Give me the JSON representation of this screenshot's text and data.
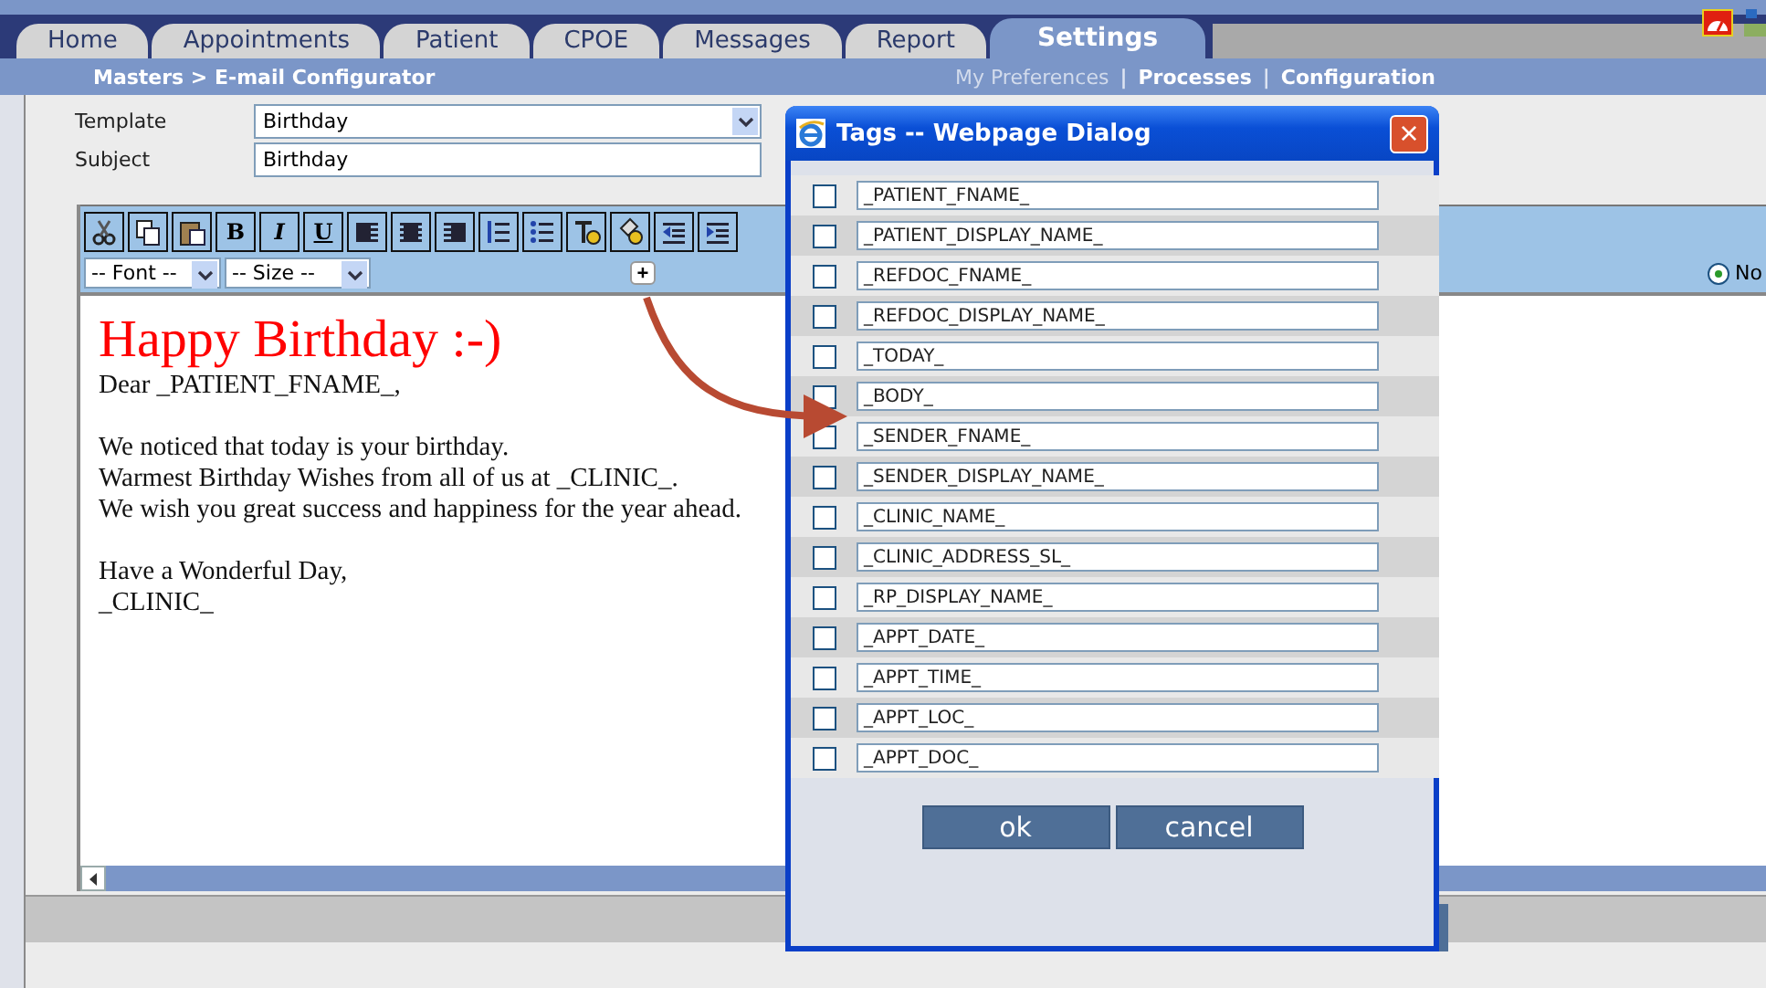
{
  "tabs": [
    {
      "label": "Home",
      "selected": false
    },
    {
      "label": "Appointments",
      "selected": false
    },
    {
      "label": "Patient",
      "selected": false
    },
    {
      "label": "CPOE",
      "selected": false
    },
    {
      "label": "Messages",
      "selected": false
    },
    {
      "label": "Report",
      "selected": false
    },
    {
      "label": "Settings",
      "selected": true
    }
  ],
  "breadcrumb": "Masters > E-mail Configurator",
  "subnav": [
    {
      "label": "My Preferences",
      "disabled": true
    },
    {
      "label": "Processes",
      "disabled": false
    },
    {
      "label": "Configuration",
      "disabled": false
    }
  ],
  "subnav_separator": "|",
  "form": {
    "template_label": "Template",
    "template_value": "Birthday",
    "subject_label": "Subject",
    "subject_value": "Birthday"
  },
  "editor": {
    "format_buttons": [
      "B",
      "I",
      "U"
    ],
    "font_select": "-- Font --",
    "size_select": "-- Size --",
    "insert_button": "+",
    "radio": {
      "label": "No",
      "selected": true
    },
    "heading": "Happy Birthday :-)",
    "paragraphs": [
      [
        "Dear _PATIENT_FNAME_,"
      ],
      [
        "We noticed that today is your birthday.",
        "Warmest Birthday Wishes from all of us at _CLINIC_.",
        "We wish you great success and happiness for the year ahead."
      ],
      [
        "Have a Wonderful Day,",
        "_CLINIC_"
      ]
    ]
  },
  "dialog": {
    "title": "Tags -- Webpage Dialog",
    "close": "×",
    "tags": [
      {
        "label": "_PATIENT_FNAME_",
        "checked": false
      },
      {
        "label": "_PATIENT_DISPLAY_NAME_",
        "checked": false
      },
      {
        "label": "_REFDOC_FNAME_",
        "checked": false
      },
      {
        "label": "_REFDOC_DISPLAY_NAME_",
        "checked": false
      },
      {
        "label": "_TODAY_",
        "checked": false
      },
      {
        "label": "_BODY_",
        "checked": false
      },
      {
        "label": "_SENDER_FNAME_",
        "checked": false
      },
      {
        "label": "_SENDER_DISPLAY_NAME_",
        "checked": false
      },
      {
        "label": "_CLINIC_NAME_",
        "checked": false
      },
      {
        "label": "_CLINIC_ADDRESS_SL_",
        "checked": false
      },
      {
        "label": "_RP_DISPLAY_NAME_",
        "checked": false
      },
      {
        "label": "_APPT_DATE_",
        "checked": false
      },
      {
        "label": "_APPT_TIME_",
        "checked": false
      },
      {
        "label": "_APPT_LOC_",
        "checked": false
      },
      {
        "label": "_APPT_DOC_",
        "checked": false
      }
    ],
    "buttons": [
      "ok",
      "cancel"
    ]
  }
}
